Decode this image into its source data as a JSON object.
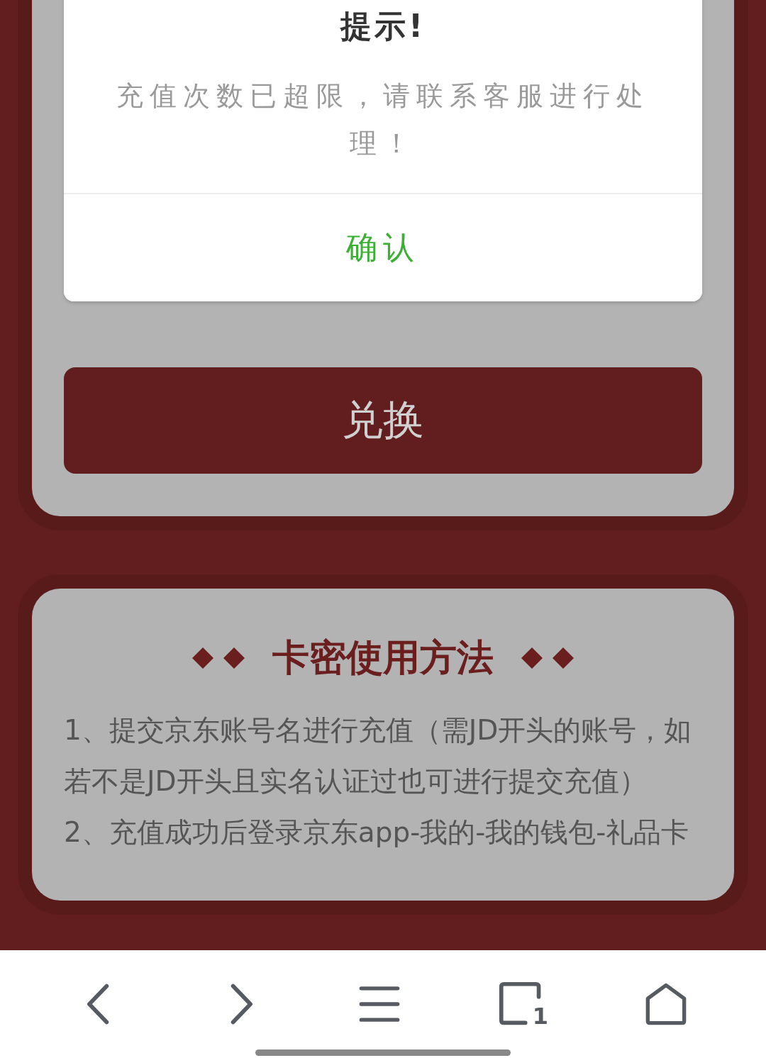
{
  "dialog": {
    "title": "提示!",
    "message": "充值次数已超限，请联系客服进行处理！",
    "confirm": "确认"
  },
  "exchange_button": "兑换",
  "instructions": {
    "title": "卡密使用方法",
    "items": [
      "1、提交京东账号名进行充值（需JD开头的账号，如若不是JD开头且实名认证过也可进行提交充值）",
      "2、充值成功后登录京东app-我的-我的钱包-礼品卡"
    ]
  },
  "browser_bar": {
    "tab_count": "1"
  }
}
